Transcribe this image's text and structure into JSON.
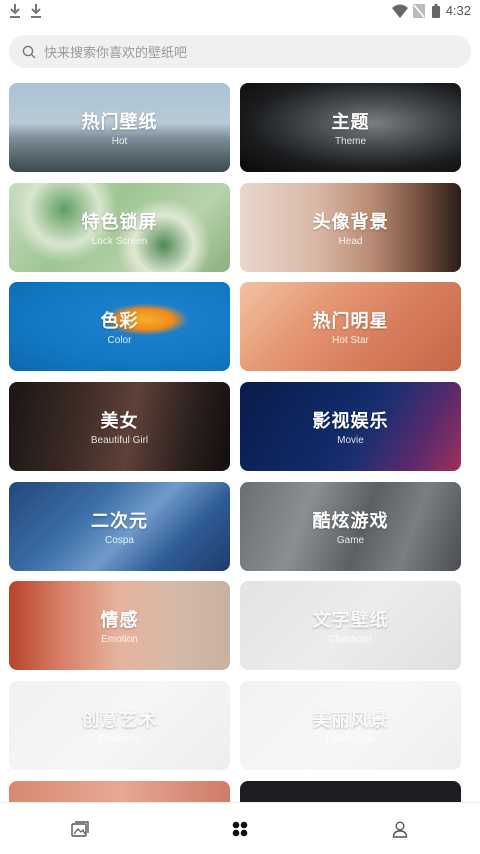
{
  "status_bar": {
    "time": "4:32"
  },
  "search": {
    "placeholder": "快来搜索你喜欢的壁纸吧"
  },
  "categories": [
    {
      "cn": "热门壁纸",
      "en": "Hot"
    },
    {
      "cn": "主题",
      "en": "Theme"
    },
    {
      "cn": "特色锁屏",
      "en": "Lock Screen"
    },
    {
      "cn": "头像背景",
      "en": "Head"
    },
    {
      "cn": "色彩",
      "en": "Color"
    },
    {
      "cn": "热门明星",
      "en": "Hot Star"
    },
    {
      "cn": "美女",
      "en": "Beautiful Girl"
    },
    {
      "cn": "影视娱乐",
      "en": "Movie"
    },
    {
      "cn": "二次元",
      "en": "Cospa"
    },
    {
      "cn": "酷炫游戏",
      "en": "Game"
    },
    {
      "cn": "情感",
      "en": "Emotion"
    },
    {
      "cn": "文字壁纸",
      "en": "Character"
    },
    {
      "cn": "创意艺术",
      "en": "Creativity"
    },
    {
      "cn": "美丽风景",
      "en": "Landscape"
    }
  ],
  "bottom_nav": {
    "items": [
      "gallery-icon",
      "grid-icon",
      "user-icon"
    ],
    "active_color": "#111111",
    "inactive_color": "#555555"
  }
}
